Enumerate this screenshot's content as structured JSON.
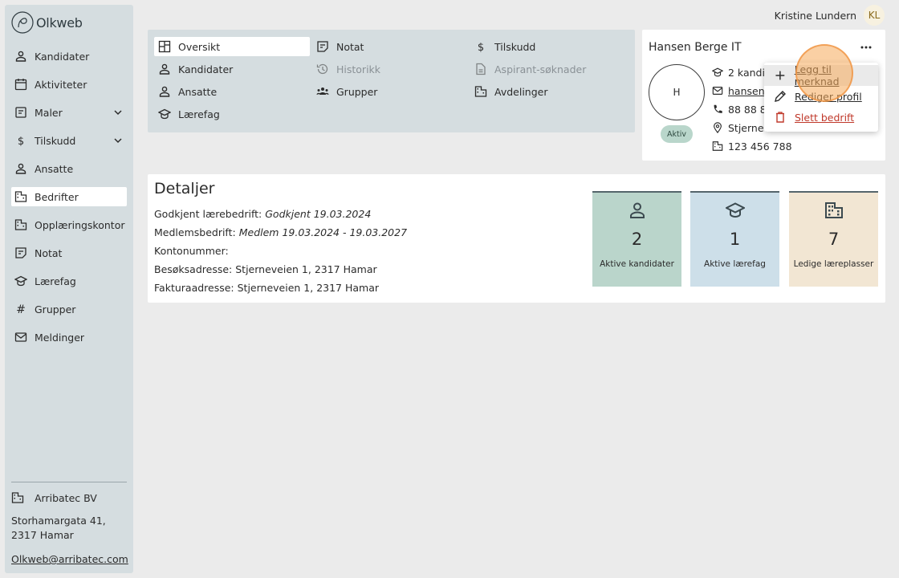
{
  "app": {
    "name": "Olkweb"
  },
  "user": {
    "name": "Kristine Lundern",
    "initials": "KL"
  },
  "sidebar": {
    "items": [
      {
        "label": "Kandidater",
        "icon": "person-icon"
      },
      {
        "label": "Aktiviteter",
        "icon": "calendar-icon"
      },
      {
        "label": "Maler",
        "icon": "document-icon",
        "expandable": true
      },
      {
        "label": "Tilskudd",
        "icon": "dollar-icon",
        "expandable": true
      },
      {
        "label": "Ansatte",
        "icon": "person-icon"
      },
      {
        "label": "Bedrifter",
        "icon": "building-icon",
        "active": true
      },
      {
        "label": "Opplæringskontor",
        "icon": "building-icon"
      },
      {
        "label": "Notat",
        "icon": "note-icon"
      },
      {
        "label": "Lærefag",
        "icon": "graduation-cap-icon"
      },
      {
        "label": "Grupper",
        "icon": "hashtag-icon"
      },
      {
        "label": "Meldinger",
        "icon": "mail-icon"
      }
    ],
    "org": {
      "name": "Arribatec BV",
      "address": "Storhamargata 41, 2317 Hamar",
      "email": "Olkweb@arribatec.com"
    }
  },
  "tabs": [
    {
      "label": "Oversikt",
      "icon": "dashboard-icon",
      "active": true
    },
    {
      "label": "Kandidater",
      "icon": "person-icon"
    },
    {
      "label": "Ansatte",
      "icon": "person-icon"
    },
    {
      "label": "Lærefag",
      "icon": "graduation-cap-icon"
    },
    {
      "label": "Notat",
      "icon": "note-icon"
    },
    {
      "label": "Historikk",
      "icon": "history-icon",
      "disabled": true
    },
    {
      "label": "Grupper",
      "icon": "group-icon"
    },
    {
      "label": "Tilskudd",
      "icon": "dollar-icon"
    },
    {
      "label": "Aspirant-søknader",
      "icon": "file-icon",
      "disabled": true
    },
    {
      "label": "Avdelinger",
      "icon": "building-icon"
    }
  ],
  "company": {
    "name": "Hansen Berge IT",
    "avatar_letter": "H",
    "status": "Aktiv",
    "info": {
      "candidates": "2 kandid",
      "email": "hansenb",
      "phone": "88 88 88",
      "address": "Stjernev",
      "org_number": "123 456 788"
    }
  },
  "menu": {
    "items": [
      {
        "label": "Legg til merknad",
        "icon": "plus-icon"
      },
      {
        "label": "Rediger profil",
        "icon": "pencil-icon"
      },
      {
        "label": "Slett bedrift",
        "icon": "trash-icon"
      }
    ]
  },
  "details": {
    "title": "Detaljer",
    "rows": [
      {
        "key": "Godkjent lærebedrift:",
        "value": "Godkjent 19.03.2024"
      },
      {
        "key": "Medlemsbedrift:",
        "value": "Medlem 19.03.2024 - 19.03.2027"
      },
      {
        "key": "Kontonummer:",
        "value": ""
      },
      {
        "key": "Besøksadresse:",
        "value": "Stjerneveien 1, 2317 Hamar"
      },
      {
        "key": "Fakturaadresse:",
        "value": "Stjerneveien 1, 2317 Hamar"
      }
    ],
    "stats": [
      {
        "value": "2",
        "label": "Aktive kandidater",
        "icon": "person-icon",
        "color": "#bad5cb"
      },
      {
        "value": "1",
        "label": "Aktive lærefag",
        "icon": "graduation-cap-icon",
        "color": "#cddfe9"
      },
      {
        "value": "7",
        "label": "Ledige læreplasser",
        "icon": "building-icon",
        "color": "#f2e6d3"
      }
    ]
  },
  "colors": {
    "sidebar_bg": "#d5dde0",
    "page_bg": "#ebebeb",
    "danger": "#c0392b",
    "highlight": "#f5aa5a"
  }
}
